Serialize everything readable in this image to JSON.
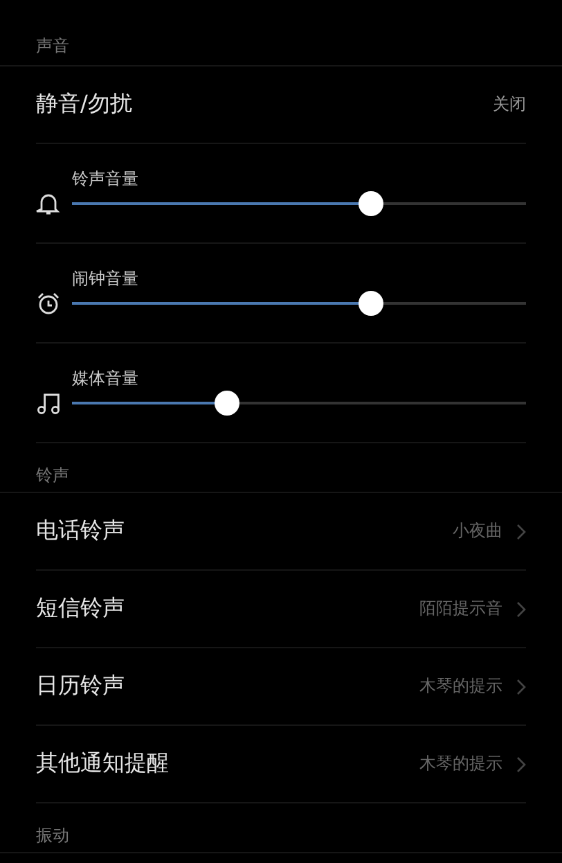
{
  "sections": [
    {
      "title": "声音",
      "items": [
        {
          "kind": "value",
          "label": "静音/勿扰",
          "value": "关闭"
        },
        {
          "kind": "slider",
          "label": "铃声音量",
          "level": 0.66
        },
        {
          "kind": "slider",
          "label": "闹钟音量",
          "level": 0.66
        },
        {
          "kind": "slider",
          "label": "媒体音量",
          "level": 0.34
        }
      ]
    },
    {
      "title": "铃声",
      "items": [
        {
          "kind": "link",
          "label": "电话铃声",
          "value": "小夜曲"
        },
        {
          "kind": "link",
          "label": "短信铃声",
          "value": "陌陌提示音"
        },
        {
          "kind": "link",
          "label": "日历铃声",
          "value": "木琴的提示"
        },
        {
          "kind": "link",
          "label": "其他通知提醒",
          "value": "木琴的提示"
        }
      ]
    },
    {
      "title": "振动"
    }
  ]
}
